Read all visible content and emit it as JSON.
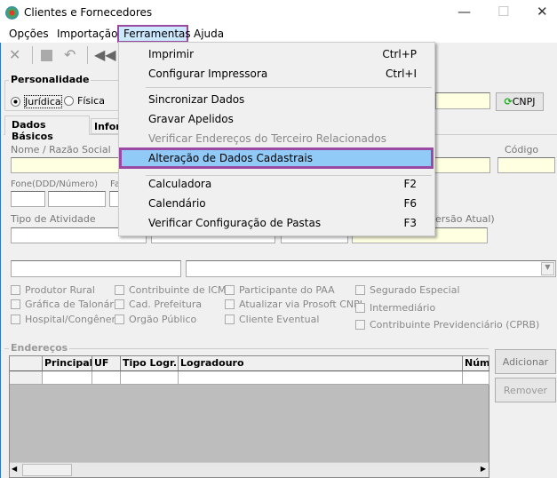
{
  "window": {
    "title": "Clientes e Fornecedores",
    "minimize": "—",
    "maximize": "☐",
    "close": "✕"
  },
  "menubar": [
    "Opções",
    "Importação",
    "Ferramentas",
    "Ajuda"
  ],
  "menu": {
    "items": [
      {
        "label": "Imprimir",
        "shortcut": "Ctrl+P"
      },
      {
        "label": "Configurar Impressora",
        "shortcut": "Ctrl+I"
      },
      {
        "label": "Sincronizar Dados",
        "shortcut": ""
      },
      {
        "label": "Gravar Apelidos",
        "shortcut": ""
      },
      {
        "label": "Verificar Endereços do Terceiro Relacionados",
        "shortcut": "",
        "disabled": true
      },
      {
        "label": "Alteração de Dados Cadastrais",
        "shortcut": "",
        "highlighted": true
      },
      {
        "label": "Calculadora",
        "shortcut": "F2"
      },
      {
        "label": "Calendário",
        "shortcut": "F6"
      },
      {
        "label": "Verificar Configuração de Pastas",
        "shortcut": "F3"
      }
    ]
  },
  "personalidade": {
    "title": "Personalidade",
    "options": [
      "Jurídica",
      "Física"
    ],
    "selected": "Jurídica"
  },
  "cnpj_button": "CNPJ",
  "tabs": [
    "Dados Básicos",
    "Infor"
  ],
  "form": {
    "nome_label": "Nome / Razão Social",
    "codigo_label": "Código",
    "fone_label": "Fone(DDD/Número)",
    "fax_label": "Fa",
    "tipo_label": "Tipo de Atividade",
    "versao_label": "ersão Atual)"
  },
  "checkboxes": [
    [
      "Produtor Rural",
      "Gráfica de Talonário",
      "Hospital/Congênere"
    ],
    [
      "Contribuinte de ICMS",
      "Cad. Prefeitura",
      "Orgão Público"
    ],
    [
      "Participante do PAA",
      "Atualizar via Prosoft CNPJ",
      "Cliente Eventual"
    ],
    [
      "Segurado Especial",
      "Intermediário",
      "Contribuinte Previdenciário (CPRB)"
    ]
  ],
  "enderecos": {
    "title": "Endereços",
    "columns": [
      "",
      "Principal",
      "UF",
      "Tipo Logr.",
      "Logradouro",
      "Núme"
    ],
    "add": "Adicionar",
    "remove": "Remover"
  },
  "colors": {
    "highlight": "#91c9f7",
    "annotation": "#9a4aa3",
    "field_yellow": "#ffffe1"
  }
}
